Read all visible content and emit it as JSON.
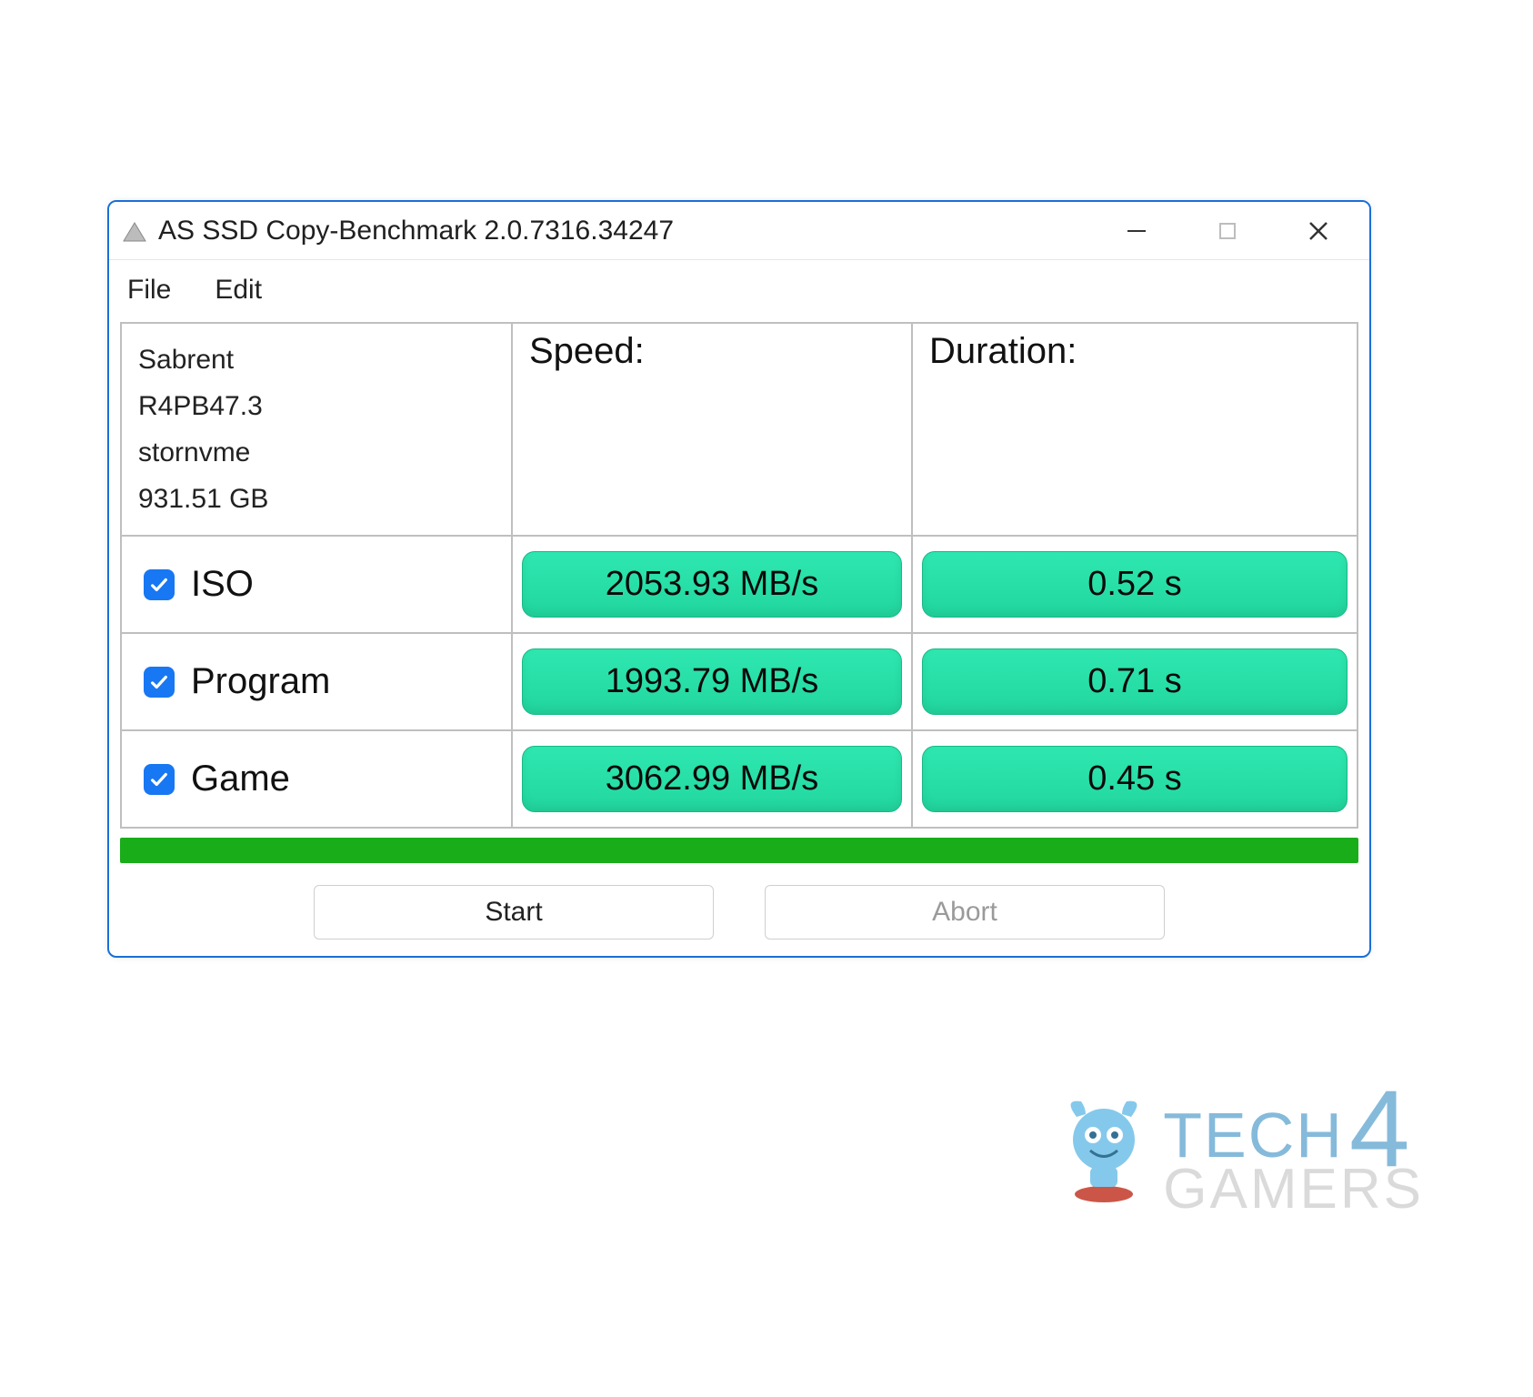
{
  "window": {
    "title": "AS SSD Copy-Benchmark 2.0.7316.34247"
  },
  "menu": {
    "file": "File",
    "edit": "Edit"
  },
  "drive": {
    "name": "Sabrent",
    "firmware": "R4PB47.3",
    "driver": "stornvme",
    "capacity": "931.51 GB"
  },
  "headers": {
    "speed": "Speed:",
    "duration": "Duration:"
  },
  "rows": [
    {
      "label": "ISO",
      "speed": "2053.93 MB/s",
      "duration": "0.52 s"
    },
    {
      "label": "Program",
      "speed": "1993.79 MB/s",
      "duration": "0.71 s"
    },
    {
      "label": "Game",
      "speed": "3062.99 MB/s",
      "duration": "0.45 s"
    }
  ],
  "buttons": {
    "start": "Start",
    "abort": "Abort"
  },
  "watermark": {
    "line1": "TECH",
    "digit": "4",
    "line2": "GAMERS"
  },
  "chart_data": {
    "type": "table",
    "title": "AS SSD Copy-Benchmark results",
    "categories": [
      "ISO",
      "Program",
      "Game"
    ],
    "series": [
      {
        "name": "Speed (MB/s)",
        "values": [
          2053.93,
          1993.79,
          3062.99
        ]
      },
      {
        "name": "Duration (s)",
        "values": [
          0.52,
          0.71,
          0.45
        ]
      }
    ]
  }
}
